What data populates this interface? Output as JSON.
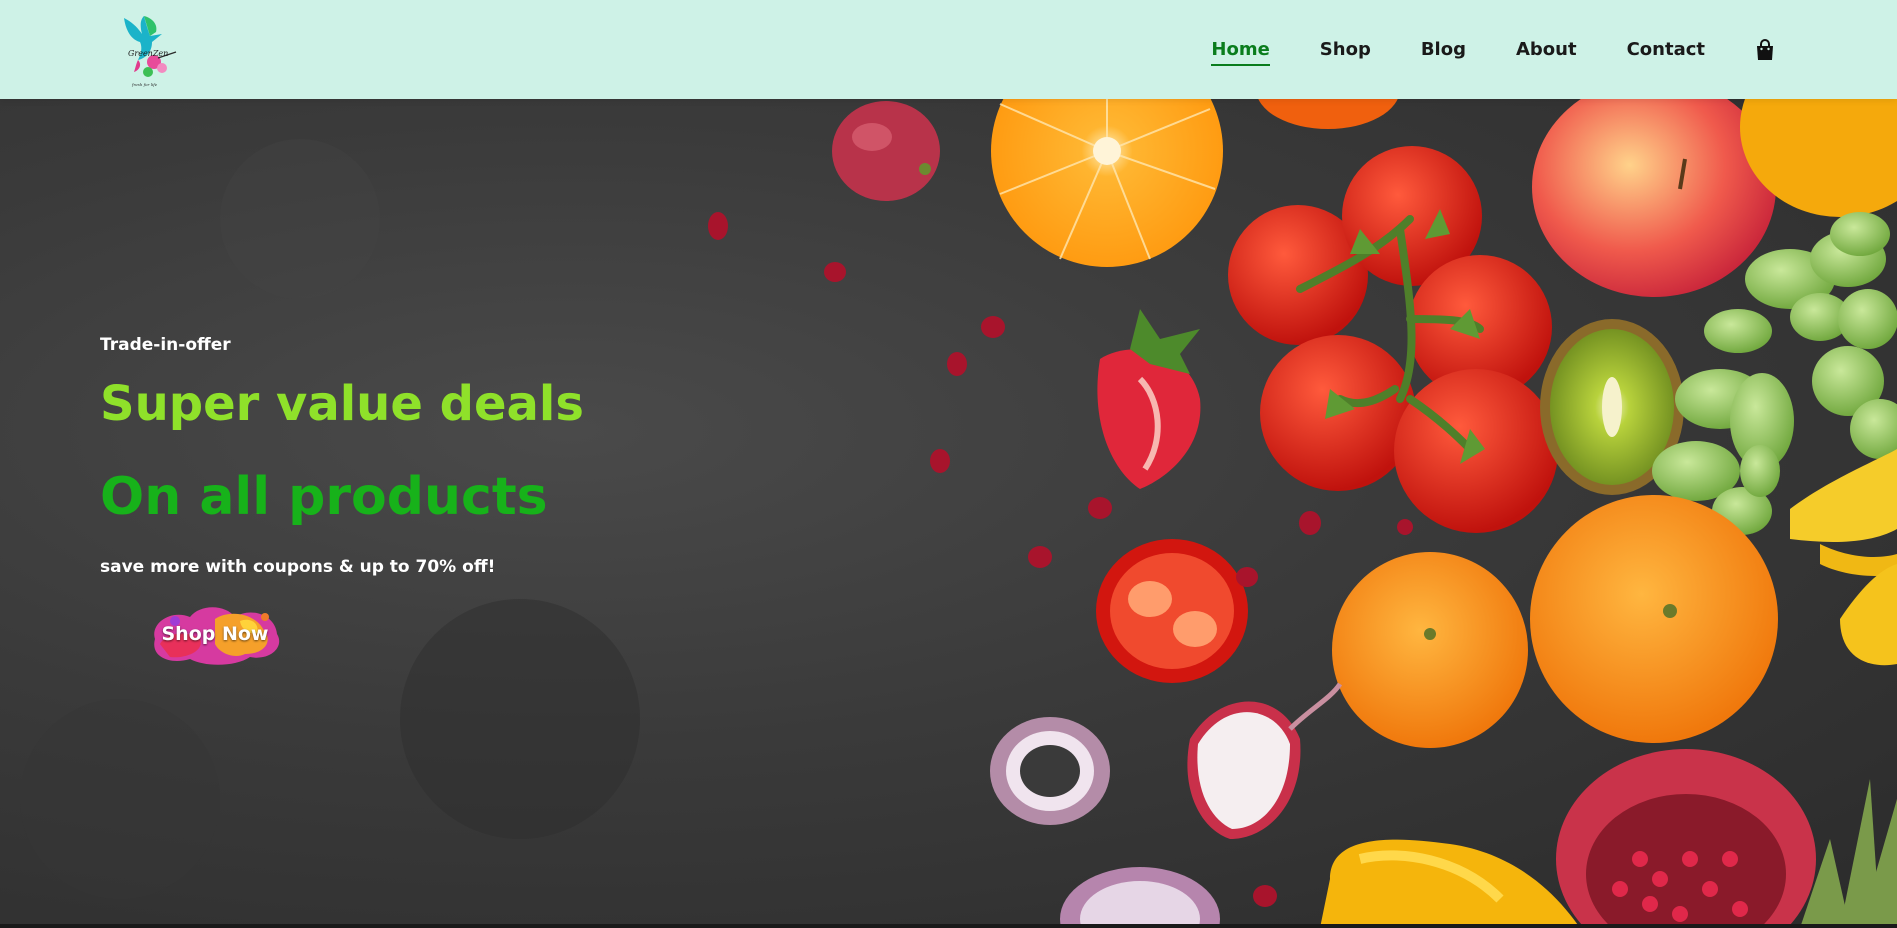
{
  "brand": {
    "logo_text": "GreenZen",
    "logo_tagline": "fresh for life"
  },
  "nav": {
    "items": [
      {
        "label": "Home",
        "active": true
      },
      {
        "label": "Shop",
        "active": false
      },
      {
        "label": "Blog",
        "active": false
      },
      {
        "label": "About",
        "active": false
      },
      {
        "label": "Contact",
        "active": false
      }
    ],
    "cart_icon": "shopping-bag-icon"
  },
  "hero": {
    "eyebrow": "Trade-in-offer",
    "headline_line1": "Super value deals",
    "headline_line2": "On all products",
    "subtext": "save more with coupons & up to 70% off!",
    "cta_label": "Shop Now"
  },
  "colors": {
    "header_bg": "#cef2e7",
    "nav_active": "#0a7d1d",
    "headline1": "#8fe12a",
    "headline2": "#17b21a",
    "hero_bg": "#3a3a3a"
  }
}
